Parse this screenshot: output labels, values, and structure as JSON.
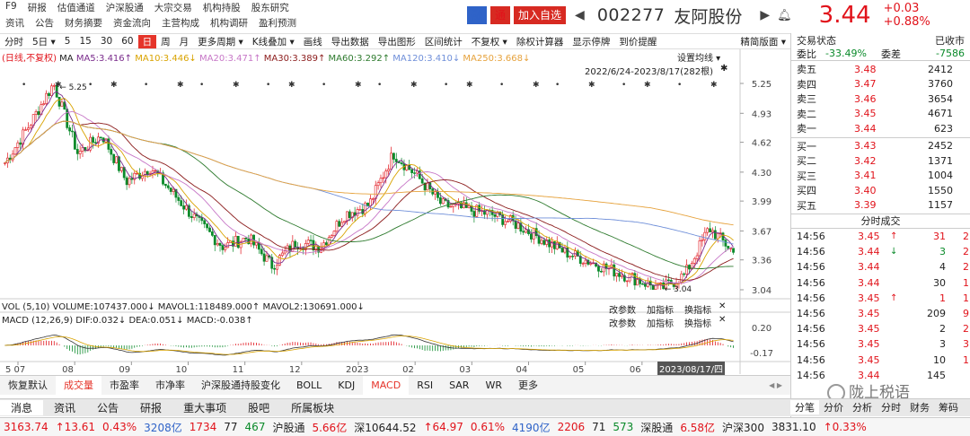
{
  "nav": {
    "row1": [
      "F9",
      "研报",
      "估值通道",
      "沪深股通",
      "大宗交易",
      "机构持股",
      "股东研究"
    ],
    "row2": [
      "资讯",
      "公告",
      "财务摘要",
      "资金流向",
      "主营构成",
      "机构调研",
      "盈利预测"
    ]
  },
  "title": {
    "tag_margin": "融",
    "tag_tong": "通",
    "add_watch": "加入自选",
    "code": "002277",
    "name": "友阿股份",
    "price": "3.44",
    "change": "+0.03",
    "change_pct": "+0.88%"
  },
  "toolbar": [
    "分时",
    "5日 ▾",
    "5",
    "15",
    "30",
    "60",
    "日",
    "周",
    "月",
    "更多周期 ▾",
    "K线叠加 ▾",
    "画线",
    "导出数据",
    "导出图形",
    "区间统计",
    "不复权 ▾",
    "除权计算器",
    "显示停牌",
    "到价提醒",
    "精简版面 ▾"
  ],
  "toolbar_active": "日",
  "legend": {
    "ma_prefix": "(日线,不复权)",
    "ma": "MA",
    "ma5": "MA5:3.416↑",
    "ma10": "MA10:3.446↓",
    "ma20": "MA20:3.471↑",
    "ma30": "MA30:3.389↑",
    "ma60": "MA60:3.292↑",
    "ma120": "MA120:3.410↓",
    "ma250": "MA250:3.668↓",
    "ma_settings": "设置均线 ▾",
    "range": "2022/6/24-2023/8/17(282根)",
    "vol": "VOL (5,10) VOLUME:107437.000↓ MAVOL1:118489.000↑ MAVOL2:130691.000↓",
    "macd": "MACD (12,26,9) DIF:0.032↓ DEA:0.051↓ MACD:-0.038↑",
    "btn_params": "改参数",
    "btn_add": "加指标",
    "btn_switch": "换指标"
  },
  "y_axis": {
    "price_ticks": [
      "5.25",
      "4.93",
      "4.62",
      "4.30",
      "3.99",
      "3.67",
      "3.36",
      "3.04"
    ],
    "macd_ticks": [
      "0.20",
      "-0.17"
    ],
    "high_label": "5.25",
    "low_label": "3.04"
  },
  "x_axis": {
    "labels": [
      "5 07",
      "08",
      "09",
      "10",
      "11",
      "12",
      "2023",
      "02",
      "03",
      "04",
      "05",
      "06",
      "07"
    ],
    "current_date": "2023/08/17/四"
  },
  "indicators": [
    "恢复默认",
    "成交量",
    "市盈率",
    "市净率",
    "沪深股通持股变化",
    "BOLL",
    "KDJ",
    "MACD",
    "RSI",
    "SAR",
    "WR",
    "更多"
  ],
  "indicators_active": [
    "成交量",
    "MACD"
  ],
  "bottom_tabs": [
    "消息",
    "资讯",
    "公告",
    "研报",
    "重大事项",
    "股吧",
    "所属板块"
  ],
  "right": {
    "header": "交易状态",
    "header_right": "已收市",
    "weibi_label": "委比",
    "weibi": "-33.49%",
    "weicha_label": "委差",
    "weicha": "-7586",
    "asks": [
      {
        "label": "卖五",
        "price": "3.48",
        "vol": "2412"
      },
      {
        "label": "卖四",
        "price": "3.47",
        "vol": "3760"
      },
      {
        "label": "卖三",
        "price": "3.46",
        "vol": "3654"
      },
      {
        "label": "卖二",
        "price": "3.45",
        "vol": "4671"
      },
      {
        "label": "卖一",
        "price": "3.44",
        "vol": "623"
      }
    ],
    "bids": [
      {
        "label": "买一",
        "price": "3.43",
        "vol": "2452"
      },
      {
        "label": "买二",
        "price": "3.42",
        "vol": "1371"
      },
      {
        "label": "买三",
        "price": "3.41",
        "vol": "1004"
      },
      {
        "label": "买四",
        "price": "3.40",
        "vol": "1550"
      },
      {
        "label": "买五",
        "price": "3.39",
        "vol": "1157"
      }
    ],
    "ticks_title": "分时成交",
    "ticks": [
      {
        "t": "14:56",
        "p": "3.45",
        "ar": "↑",
        "v": "31",
        "n": "2"
      },
      {
        "t": "14:56",
        "p": "3.44",
        "ar": "↓",
        "v": "3",
        "n": "2"
      },
      {
        "t": "14:56",
        "p": "3.44",
        "ar": "",
        "v": "4",
        "n": "2"
      },
      {
        "t": "14:56",
        "p": "3.44",
        "ar": "",
        "v": "30",
        "n": "1"
      },
      {
        "t": "14:56",
        "p": "3.45",
        "ar": "↑",
        "v": "1",
        "n": "1"
      },
      {
        "t": "14:56",
        "p": "3.45",
        "ar": "",
        "v": "209",
        "n": "9"
      },
      {
        "t": "14:56",
        "p": "3.45",
        "ar": "",
        "v": "2",
        "n": "2"
      },
      {
        "t": "14:56",
        "p": "3.45",
        "ar": "",
        "v": "3",
        "n": "3"
      },
      {
        "t": "14:56",
        "p": "3.45",
        "ar": "",
        "v": "10",
        "n": "1"
      },
      {
        "t": "14:56",
        "p": "3.44",
        "ar": "",
        "v": "145",
        "n": ""
      }
    ],
    "foot_tabs": [
      "分笔",
      "分价",
      "分析",
      "分时",
      "财务",
      "筹码"
    ],
    "watermark": "陇上税语"
  },
  "ticker": [
    {
      "text": "3163.74",
      "c": "red"
    },
    {
      "text": "↑13.61",
      "c": "red"
    },
    {
      "text": "0.43%",
      "c": "red"
    },
    {
      "text": "3208亿",
      "c": "blue"
    },
    {
      "text": "1734",
      "c": "red"
    },
    {
      "text": "77",
      "c": ""
    },
    {
      "text": "467",
      "c": "green"
    },
    {
      "text": "沪股通",
      "c": ""
    },
    {
      "text": "5.66亿",
      "c": "red"
    },
    {
      "text": "深10644.52",
      "c": ""
    },
    {
      "text": "↑64.97",
      "c": "red"
    },
    {
      "text": "0.61%",
      "c": "red"
    },
    {
      "text": "4190亿",
      "c": "blue"
    },
    {
      "text": "2206",
      "c": "red"
    },
    {
      "text": "71",
      "c": ""
    },
    {
      "text": "573",
      "c": "green"
    },
    {
      "text": "深股通",
      "c": ""
    },
    {
      "text": "6.58亿",
      "c": "red"
    },
    {
      "text": "沪深300",
      "c": ""
    },
    {
      "text": "3831.10",
      "c": ""
    },
    {
      "text": "↑0.33%",
      "c": "red"
    }
  ],
  "colors": {
    "up": "#e1131b",
    "down": "#0a8a2a",
    "ma5": "#7a2c8c",
    "ma10": "#d9a300",
    "ma20": "#c777c7",
    "ma30": "#8b1b1b",
    "ma60": "#2d7a2d",
    "ma120": "#6f8fd9",
    "ma250": "#e6a23c"
  },
  "chart_data": {
    "type": "candlestick",
    "title": "",
    "period": "2022/6/24-2023/8/17",
    "bars": 282,
    "ylim": [
      3.04,
      5.25
    ],
    "high": 5.25,
    "low": 3.04,
    "last_close": 3.44,
    "price_path": [
      4.4,
      4.8,
      5.25,
      4.5,
      4.7,
      4.2,
      4.35,
      4.05,
      3.75,
      3.5,
      3.6,
      3.3,
      3.55,
      3.5,
      3.85,
      3.95,
      4.5,
      4.25,
      3.95,
      3.9,
      3.85,
      3.75,
      3.6,
      3.45,
      3.35,
      3.25,
      3.15,
      3.05,
      3.2,
      3.7,
      3.45
    ],
    "ma_values": {
      "MA5": 3.416,
      "MA10": 3.446,
      "MA20": 3.471,
      "MA30": 3.389,
      "MA60": 3.292,
      "MA120": 3.41,
      "MA250": 3.668
    },
    "volume": {
      "VOLUME": 107437.0,
      "MAVOL1": 118489.0,
      "MAVOL2": 130691.0
    },
    "macd": {
      "DIF": 0.032,
      "DEA": 0.051,
      "MACD": -0.038
    }
  }
}
